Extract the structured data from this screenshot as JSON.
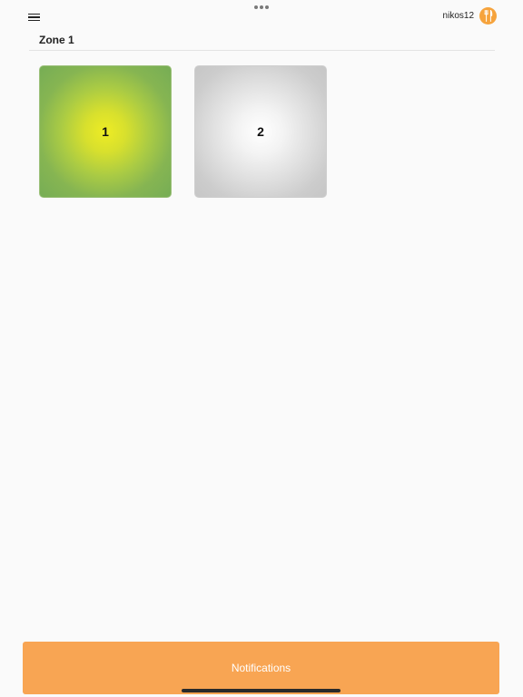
{
  "header": {
    "username": "nikos12",
    "avatar_icon": "fork-knife-icon",
    "menu_icon": "hamburger-menu-icon",
    "accent_color": "#f6a33c"
  },
  "zone": {
    "title": "Zone 1"
  },
  "tiles": [
    {
      "label": "1",
      "status_color": "#eeec24"
    },
    {
      "label": "2",
      "status_color": "#ffffff"
    }
  ],
  "footer": {
    "notifications_label": "Notifications",
    "button_color": "#f8a553"
  }
}
